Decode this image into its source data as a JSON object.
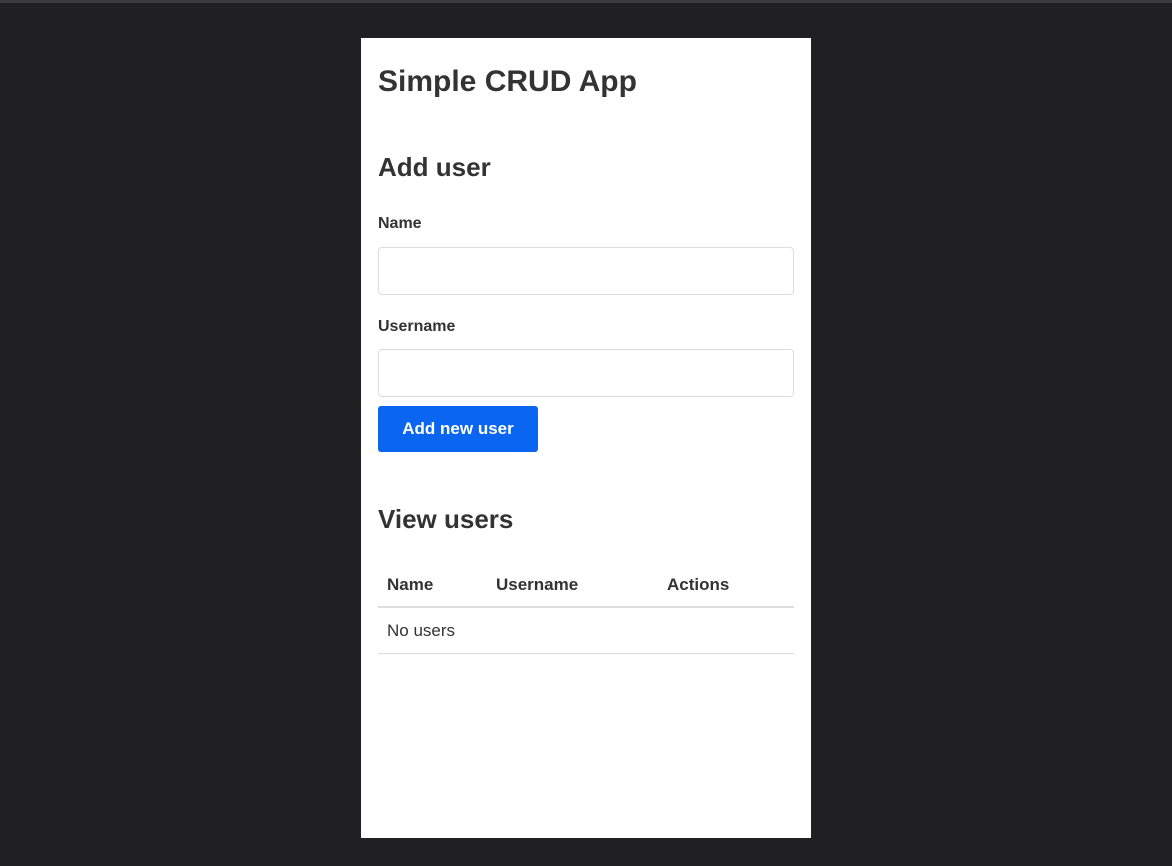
{
  "app": {
    "title": "Simple CRUD App"
  },
  "add_user": {
    "heading": "Add user",
    "name_label": "Name",
    "name_value": "",
    "username_label": "Username",
    "username_value": "",
    "submit_label": "Add new user"
  },
  "view_users": {
    "heading": "View users",
    "columns": [
      "Name",
      "Username",
      "Actions"
    ],
    "empty_message": "No users"
  },
  "colors": {
    "page_background": "#202022",
    "panel_background": "#ffffff",
    "primary_button": "#0a66f0",
    "text": "#333333"
  }
}
